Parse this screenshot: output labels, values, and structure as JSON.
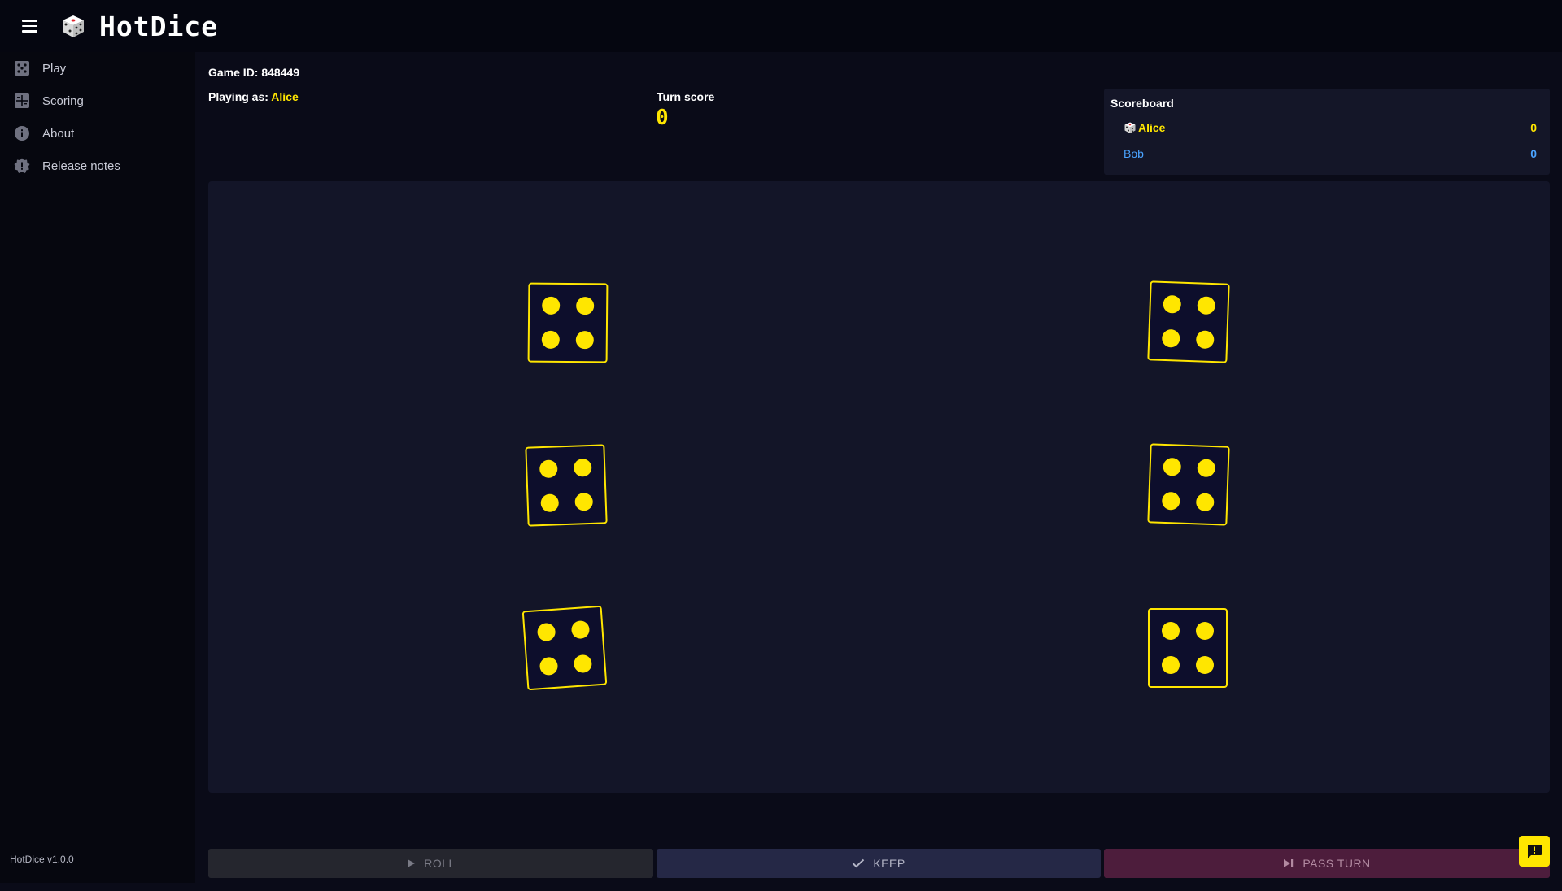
{
  "app": {
    "title": "HotDice",
    "version": "HotDice v1.0.0"
  },
  "icons": {
    "menu": "hamburger-menu-icon",
    "logo": "dice-logo-icon",
    "feedback": "feedback-icon"
  },
  "sidebar": {
    "items": [
      {
        "label": "Play",
        "icon": "dice-icon"
      },
      {
        "label": "Scoring",
        "icon": "scoring-table-icon"
      },
      {
        "label": "About",
        "icon": "info-icon"
      },
      {
        "label": "Release notes",
        "icon": "badge-icon"
      }
    ]
  },
  "game": {
    "id_label": "Game ID: 848449",
    "playing_as_label": "Playing as: ",
    "player_name": "Alice",
    "turn_score_label": "Turn score",
    "turn_score": "0"
  },
  "scoreboard": {
    "title": "Scoreboard",
    "players": [
      {
        "name": "Alice",
        "score": "0",
        "active": true,
        "color": "#ffe600"
      },
      {
        "name": "Bob",
        "score": "0",
        "active": false,
        "color": "#4aa3ff"
      }
    ]
  },
  "dice": [
    {
      "value": 4
    },
    {
      "value": 4
    },
    {
      "value": 4
    },
    {
      "value": 4
    },
    {
      "value": 4
    },
    {
      "value": 4
    }
  ],
  "actions": {
    "roll": "ROLL",
    "keep": "KEEP",
    "pass": "PASS TURN"
  },
  "colors": {
    "accent": "#ffe600",
    "background": "#0a0b18",
    "panel": "#131528",
    "player2": "#4aa3ff"
  }
}
